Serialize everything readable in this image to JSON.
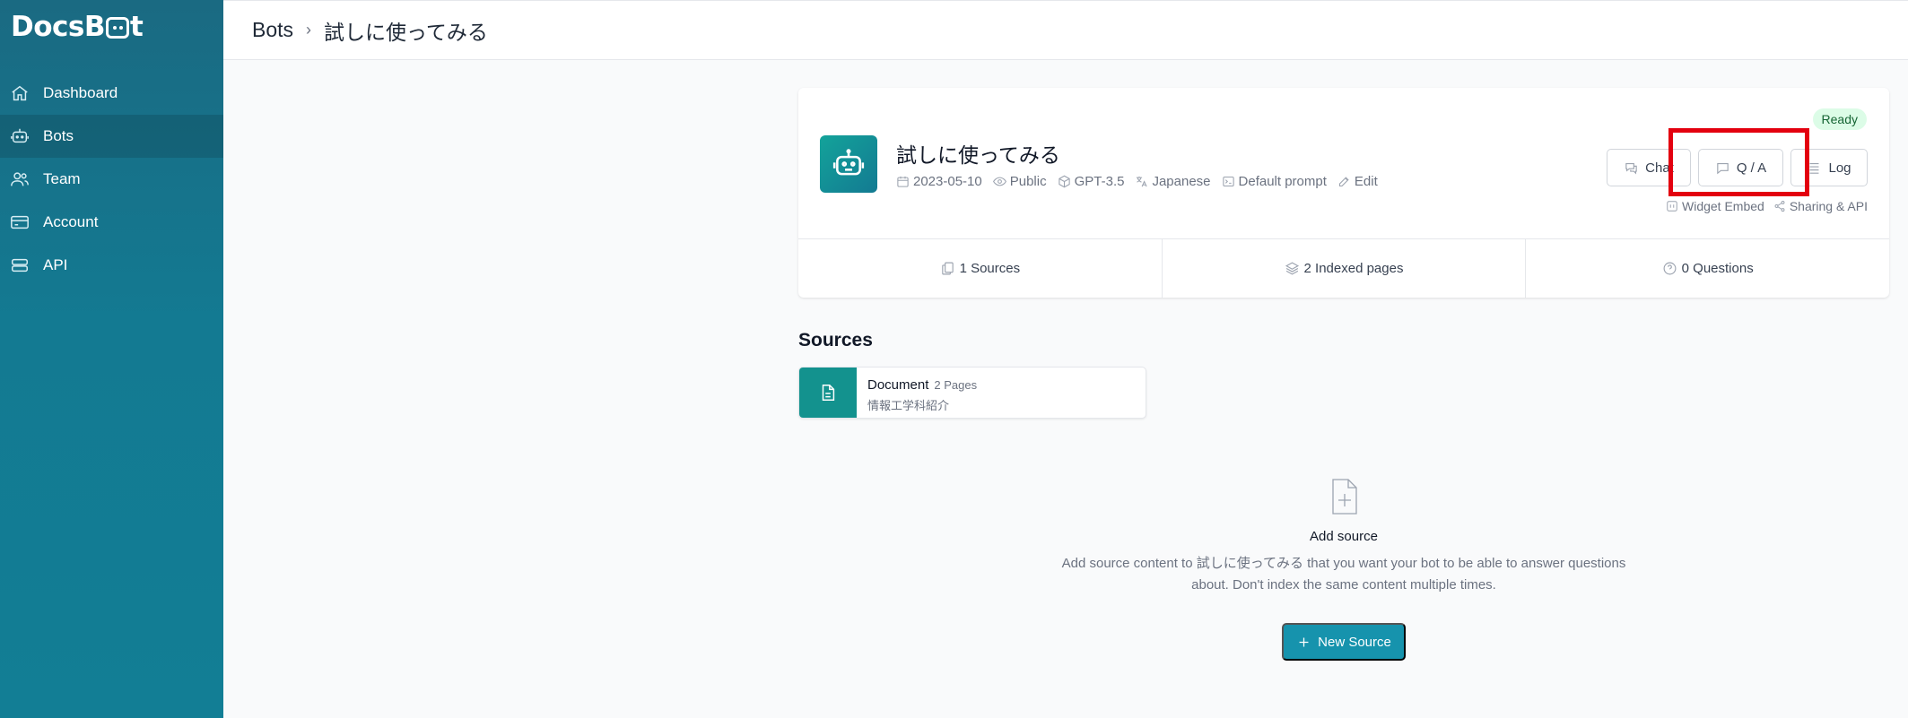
{
  "brand": {
    "logo_left": "Docs",
    "logo_b": "B",
    "logo_right": "t"
  },
  "sidebar": {
    "items": [
      {
        "label": "Dashboard",
        "icon": "home-icon"
      },
      {
        "label": "Bots",
        "icon": "bot-icon",
        "active": true
      },
      {
        "label": "Team",
        "icon": "users-icon"
      },
      {
        "label": "Account",
        "icon": "credit-card-icon"
      },
      {
        "label": "API",
        "icon": "server-icon"
      }
    ]
  },
  "breadcrumb": {
    "root": "Bots",
    "separator": "›",
    "current": "試しに使ってみる"
  },
  "bot": {
    "title": "試しに使ってみる",
    "status": "Ready",
    "meta": {
      "date": "2023-05-10",
      "visibility": "Public",
      "model": "GPT-3.5",
      "language": "Japanese",
      "prompt": "Default prompt",
      "edit": "Edit"
    },
    "buttons": {
      "chat": "Chat",
      "qa": "Q / A",
      "log": "Log"
    },
    "links": {
      "widget": "Widget Embed",
      "sharing": "Sharing & API"
    },
    "stats": {
      "sources": "1 Sources",
      "pages": "2 Indexed pages",
      "questions": "0 Questions"
    }
  },
  "sources": {
    "title": "Sources",
    "items": [
      {
        "type": "Document",
        "pages": "2 Pages",
        "name": "情報工学科紹介"
      }
    ]
  },
  "empty": {
    "heading": "Add source",
    "line1": "Add source content to 試しに使ってみる that you want your bot to be able to answer questions",
    "line2": "about. Don't index the same content multiple times.",
    "button": "New Source"
  },
  "colors": {
    "sidebar": "#137a92",
    "accent": "#1693ad",
    "highlight": "#e3000f",
    "ready_bg": "#dcfce7"
  }
}
